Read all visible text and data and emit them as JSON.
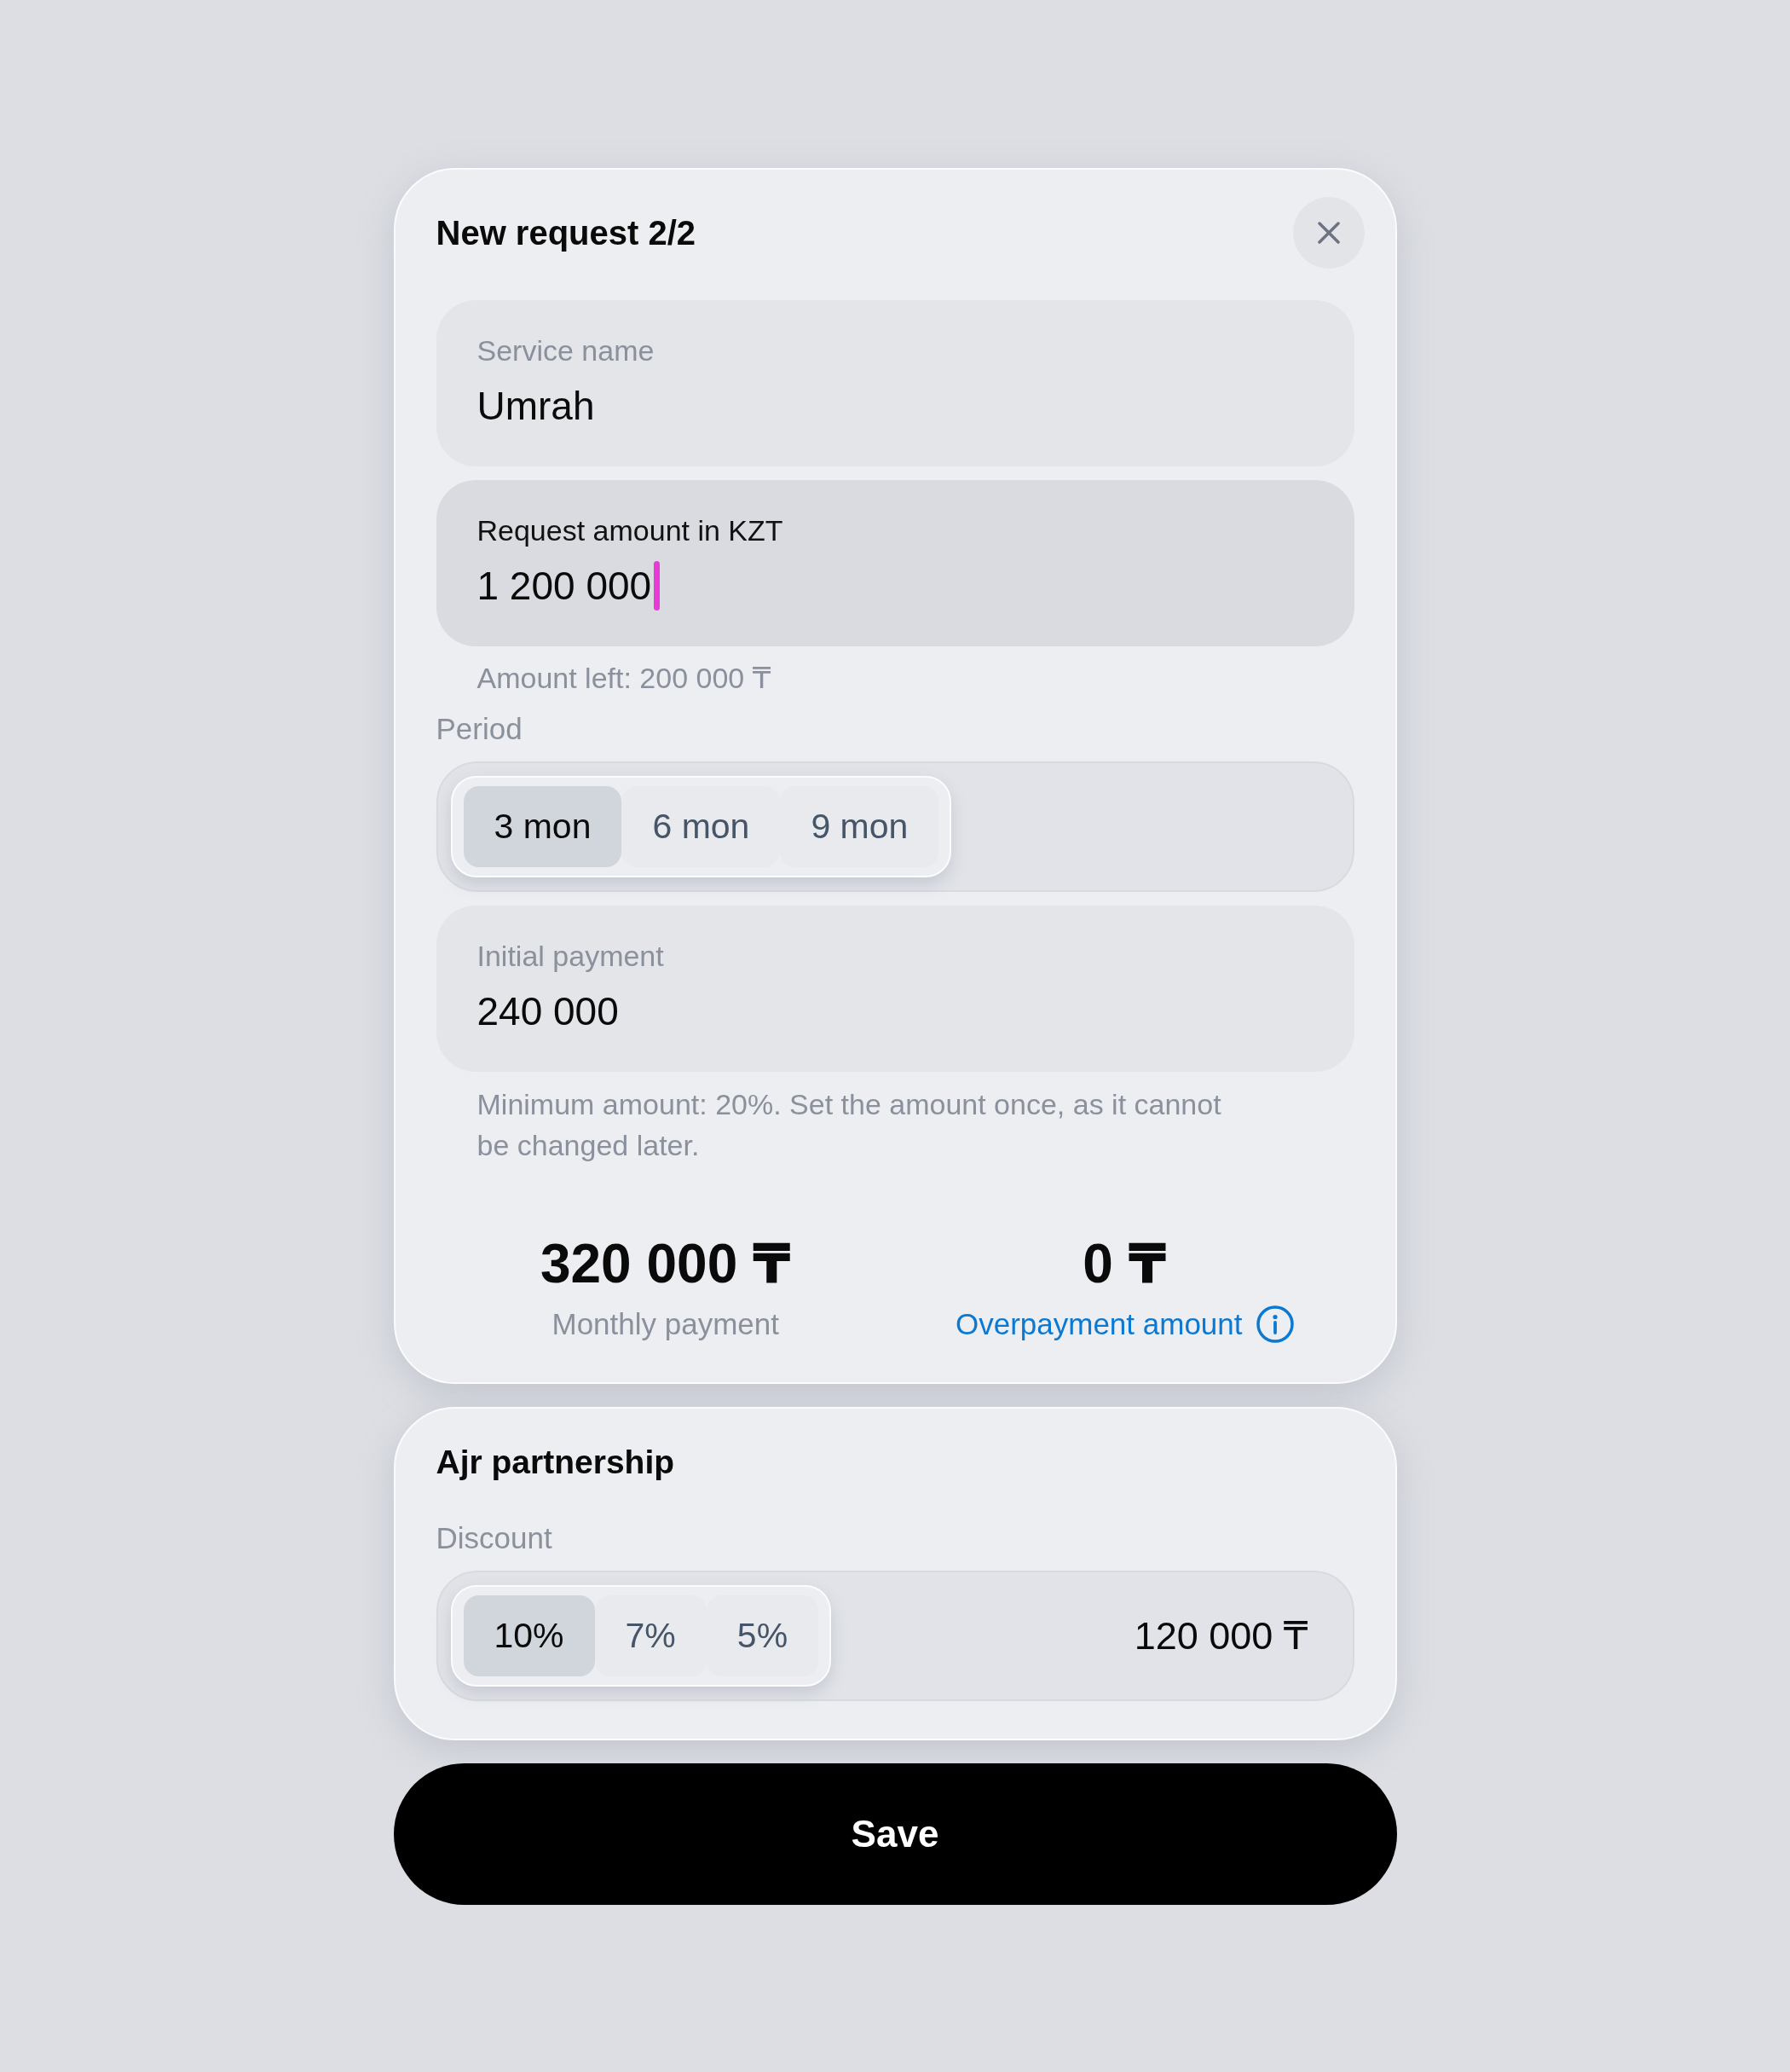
{
  "dialog": {
    "title": "New request 2/2"
  },
  "fields": [
    {
      "label": "Service name",
      "value": "Umrah",
      "focused": false
    },
    {
      "label": "Request amount in KZT",
      "value": "1 200 000",
      "focused": true
    }
  ],
  "amount_left": "Amount left: 200 000 ₸",
  "period": {
    "label": "Period",
    "options": [
      {
        "label": "3 mon",
        "selected": true
      },
      {
        "label": "6 mon",
        "selected": false
      },
      {
        "label": "9 mon",
        "selected": false
      }
    ]
  },
  "initial_payment": {
    "label": "Initial payment",
    "value": "240 000",
    "focused": false
  },
  "hint": "Minimum amount: 20%. Set the amount once, as it cannot be changed later.",
  "summary": [
    {
      "kind": "plain",
      "value": "320 000 ₸",
      "label": "Monthly payment"
    },
    {
      "kind": "info",
      "value": "0 ₸",
      "label": "Overpayment amount"
    }
  ],
  "partnership": {
    "title": "Ajr partnership",
    "discount": {
      "label": "Discount",
      "options": [
        {
          "label": "10%",
          "selected": true
        },
        {
          "label": "7%",
          "selected": false
        },
        {
          "label": "5%",
          "selected": false
        }
      ],
      "amount": "120 000 ₸"
    }
  },
  "save_button": "Save"
}
